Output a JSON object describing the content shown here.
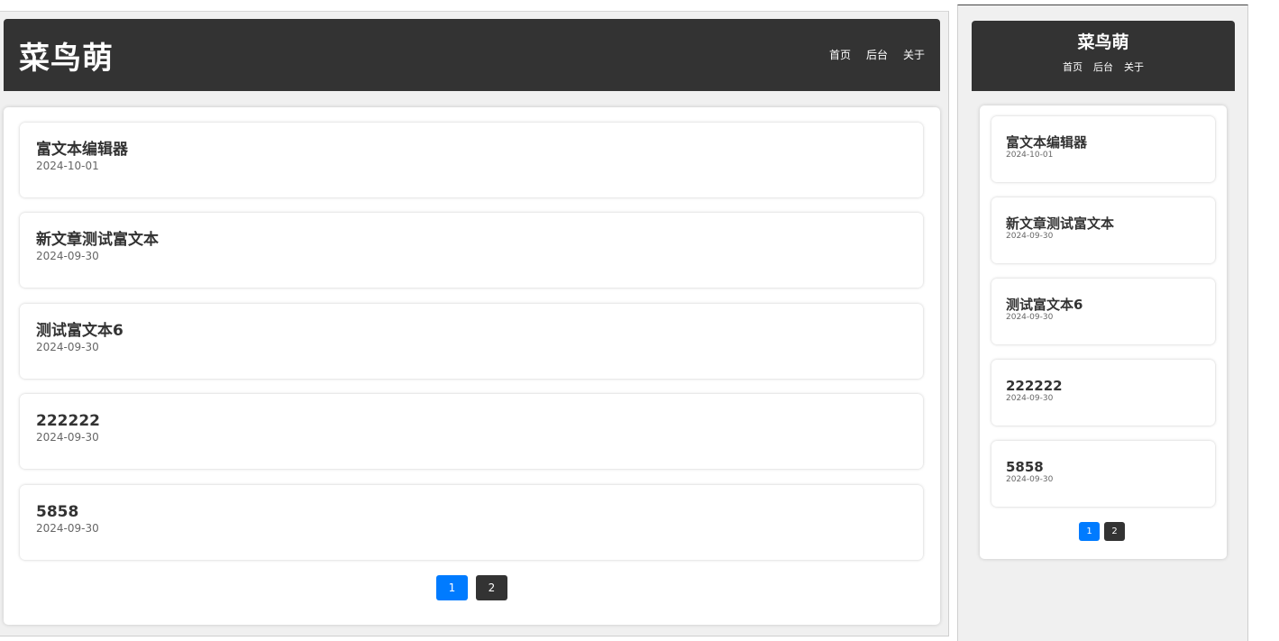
{
  "site": {
    "logo": "菜鸟萌"
  },
  "nav": [
    {
      "label": "首页"
    },
    {
      "label": "后台"
    },
    {
      "label": "关于"
    }
  ],
  "posts": [
    {
      "title": "富文本编辑器",
      "date": "2024-10-01"
    },
    {
      "title": "新文章测试富文本",
      "date": "2024-09-30"
    },
    {
      "title": "测试富文本6",
      "date": "2024-09-30"
    },
    {
      "title": "222222",
      "date": "2024-09-30"
    },
    {
      "title": "5858",
      "date": "2024-09-30"
    }
  ],
  "pagination": {
    "pages": [
      "1",
      "2"
    ],
    "current": "1",
    "active_color": "#007bff",
    "inactive_color": "#333333"
  }
}
